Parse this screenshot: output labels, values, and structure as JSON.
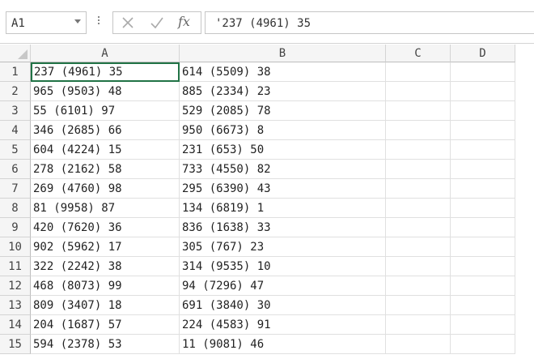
{
  "formula_bar": {
    "name_box": "A1",
    "fx_label": "fx",
    "formula": "'237 (4961) 35"
  },
  "columns": [
    "A",
    "B",
    "C",
    "D"
  ],
  "rows": [
    {
      "num": "1",
      "a": "237 (4961) 35",
      "b": "614 (5509) 38"
    },
    {
      "num": "2",
      "a": "965 (9503) 48",
      "b": "885 (2334) 23"
    },
    {
      "num": "3",
      "a": "55 (6101) 97",
      "b": "529 (2085) 78"
    },
    {
      "num": "4",
      "a": "346 (2685) 66",
      "b": "950 (6673) 8"
    },
    {
      "num": "5",
      "a": "604 (4224) 15",
      "b": "231 (653) 50"
    },
    {
      "num": "6",
      "a": "278 (2162) 58",
      "b": "733 (4550) 82"
    },
    {
      "num": "7",
      "a": "269 (4760) 98",
      "b": "295 (6390) 43"
    },
    {
      "num": "8",
      "a": "81 (9958) 87",
      "b": "134 (6819) 1"
    },
    {
      "num": "9",
      "a": "420 (7620) 36",
      "b": "836 (1638) 33"
    },
    {
      "num": "10",
      "a": "902 (5962) 17",
      "b": "305 (767) 23"
    },
    {
      "num": "11",
      "a": "322 (2242) 38",
      "b": "314 (9535) 10"
    },
    {
      "num": "12",
      "a": "468 (8073) 99",
      "b": "94 (7296) 47"
    },
    {
      "num": "13",
      "a": "809 (3407) 18",
      "b": "691 (3840) 30"
    },
    {
      "num": "14",
      "a": "204 (1687) 57",
      "b": "224 (4583) 91"
    },
    {
      "num": "15",
      "a": "594 (2378) 53",
      "b": "11 (9081) 46"
    }
  ]
}
